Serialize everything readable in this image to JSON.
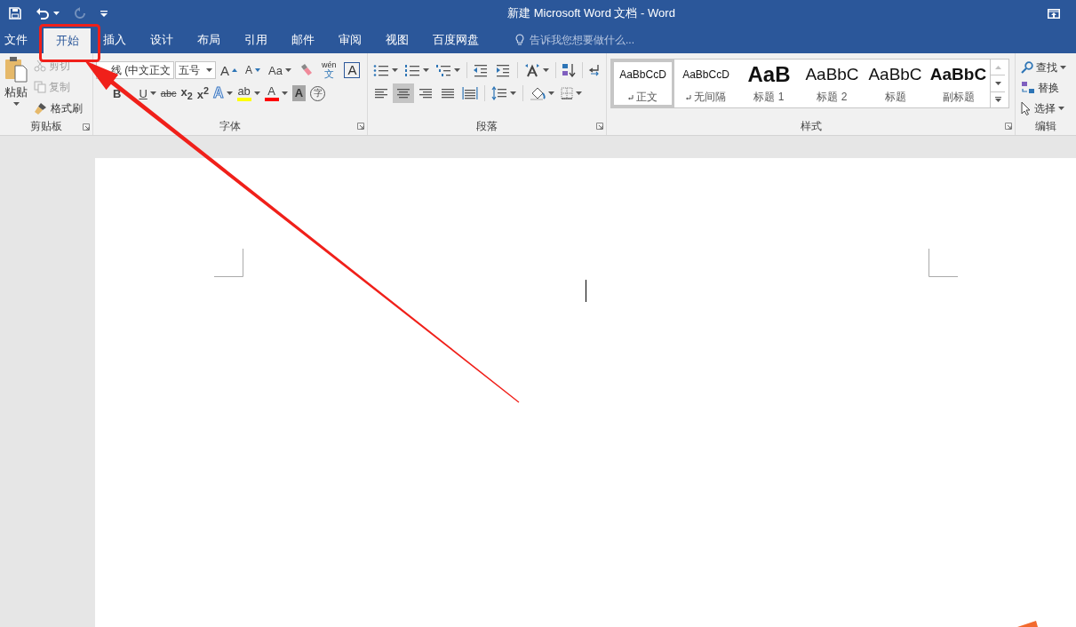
{
  "title_bar": {
    "title": "新建 Microsoft Word 文档 - Word",
    "quick_access": [
      {
        "kind": "save",
        "disabled": false
      },
      {
        "kind": "undo",
        "disabled": false,
        "dropdown": true
      },
      {
        "kind": "redo",
        "disabled": true
      },
      {
        "kind": "customize",
        "disabled": false
      }
    ]
  },
  "tabs": [
    {
      "label": "文件",
      "selected": false
    },
    {
      "label": "开始",
      "selected": true
    },
    {
      "label": "插入",
      "selected": false
    },
    {
      "label": "设计",
      "selected": false
    },
    {
      "label": "布局",
      "selected": false
    },
    {
      "label": "引用",
      "selected": false
    },
    {
      "label": "邮件",
      "selected": false
    },
    {
      "label": "审阅",
      "selected": false
    },
    {
      "label": "视图",
      "selected": false
    },
    {
      "label": "百度网盘",
      "selected": false
    }
  ],
  "tell_me": {
    "placeholder": "告诉我您想要做什么..."
  },
  "clipboard": {
    "label": "剪贴板",
    "paste": "粘贴",
    "items": [
      {
        "kind": "cut",
        "label": "剪切",
        "disabled": true
      },
      {
        "kind": "copy",
        "label": "复制",
        "disabled": true
      },
      {
        "kind": "format_painter",
        "label": "格式刷",
        "disabled": false
      }
    ]
  },
  "font": {
    "label": "字体",
    "font_name": "线 (中文正文",
    "font_size": "五号",
    "row1": [
      {
        "kind": "grow",
        "label": "A"
      },
      {
        "kind": "shrink",
        "label": "A"
      },
      {
        "kind": "case",
        "label": "Aa",
        "dropdown": true
      },
      {
        "kind": "clear"
      },
      {
        "kind": "phonetic",
        "label": "wén",
        "sub": "文"
      },
      {
        "kind": "border",
        "label": "A"
      }
    ],
    "row2": [
      {
        "kind": "bold",
        "label": "B"
      },
      {
        "kind": "underline",
        "label": "U",
        "dropdown": true
      },
      {
        "kind": "strike",
        "label": "abc"
      },
      {
        "kind": "subscript",
        "label": "x",
        "script": "2"
      },
      {
        "kind": "superscript",
        "label": "x",
        "script": "2"
      },
      {
        "kind": "effects",
        "label": "A",
        "dropdown": true
      },
      {
        "kind": "highlight",
        "label": "ab",
        "dropdown": true
      },
      {
        "kind": "color",
        "label": "A",
        "dropdown": true
      },
      {
        "kind": "shading",
        "label": "A"
      },
      {
        "kind": "enclose",
        "label": "字"
      }
    ]
  },
  "paragraph": {
    "label": "段落",
    "alignment": [
      {
        "kind": "left",
        "selected": false
      },
      {
        "kind": "center",
        "selected": true
      },
      {
        "kind": "right",
        "selected": false
      },
      {
        "kind": "justify",
        "selected": false
      },
      {
        "kind": "distributed",
        "selected": false
      }
    ]
  },
  "styles": {
    "label": "样式",
    "items": [
      {
        "kind": "normal",
        "preview": "AaBbCcD",
        "name": "正文",
        "paragraph_mark": true,
        "selected": true
      },
      {
        "kind": "no_spacing",
        "preview": "AaBbCcD",
        "name": "无间隔",
        "paragraph_mark": true,
        "selected": false
      },
      {
        "kind": "heading1",
        "preview": "AaB",
        "name": "标题 1",
        "selected": false
      },
      {
        "kind": "heading2",
        "preview": "AaBbC",
        "name": "标题 2",
        "selected": false
      },
      {
        "kind": "title",
        "preview": "AaBbC",
        "name": "标题",
        "selected": false
      },
      {
        "kind": "subtitle",
        "preview": "AaBbC",
        "name": "副标题",
        "selected": false
      }
    ]
  },
  "editing": {
    "label": "编辑",
    "items": [
      {
        "kind": "find",
        "label": "查找",
        "dropdown": true
      },
      {
        "kind": "replace",
        "label": "替换"
      },
      {
        "kind": "select",
        "label": "选择",
        "dropdown": true
      }
    ]
  }
}
